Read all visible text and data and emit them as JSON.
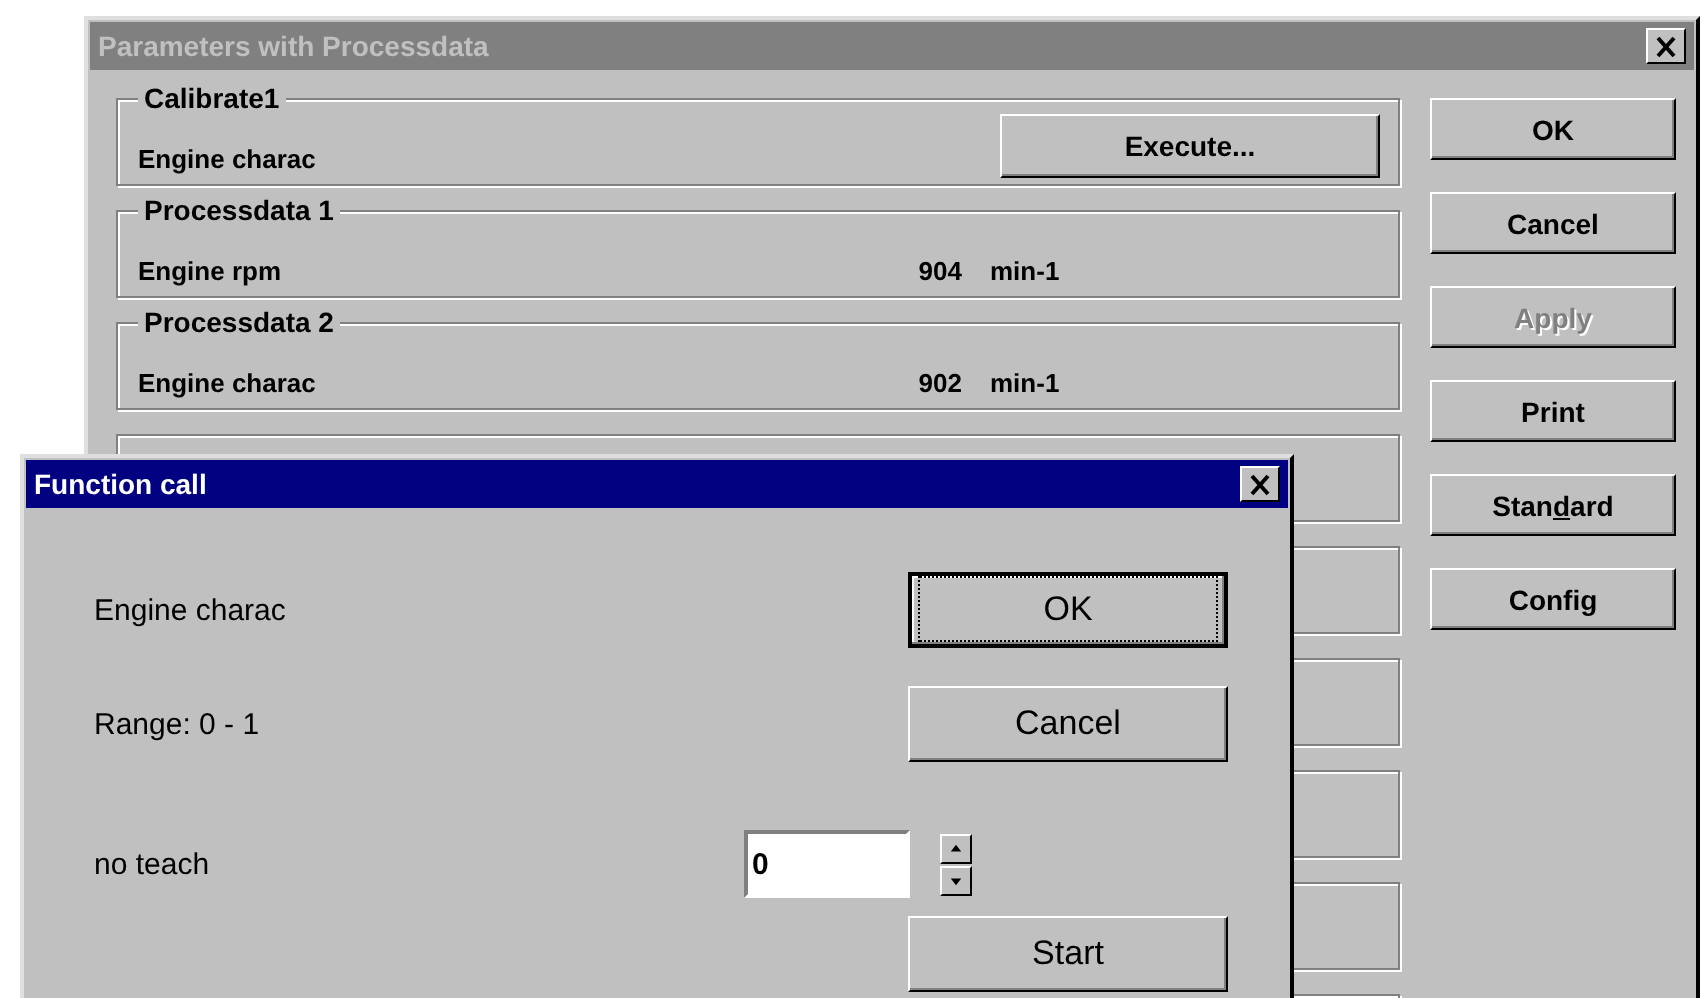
{
  "main_window": {
    "title": "Parameters with Processdata",
    "active": false,
    "groups": [
      {
        "kind": "button",
        "title": "Calibrate1",
        "label": "Engine charac",
        "button": "Execute..."
      },
      {
        "kind": "reading",
        "title": "Processdata 1",
        "label": "Engine rpm",
        "value": "904",
        "unit": "min-1"
      },
      {
        "kind": "reading",
        "title": "Processdata 2",
        "label": "Engine charac",
        "value": "902",
        "unit": "min-1"
      },
      {
        "kind": "empty"
      },
      {
        "kind": "empty"
      },
      {
        "kind": "empty"
      },
      {
        "kind": "empty"
      },
      {
        "kind": "empty"
      },
      {
        "kind": "empty"
      }
    ],
    "buttons": [
      {
        "label": "OK",
        "disabled": false
      },
      {
        "label": "Cancel",
        "disabled": false
      },
      {
        "label": "Apply",
        "disabled": true
      },
      {
        "label": "Print",
        "disabled": false
      },
      {
        "label": "Stan",
        "access_key": "d",
        "label_end": "ard",
        "disabled": false
      },
      {
        "label": "Config",
        "disabled": false
      }
    ]
  },
  "dialog": {
    "title": "Function call",
    "active": true,
    "name": "Engine charac",
    "range": "Range: 0 - 1",
    "field_label": "no teach",
    "value": "0",
    "buttons": [
      {
        "label": "OK",
        "default": true
      },
      {
        "label": "Cancel",
        "default": false
      },
      {
        "label": "Start",
        "default": false
      }
    ]
  }
}
